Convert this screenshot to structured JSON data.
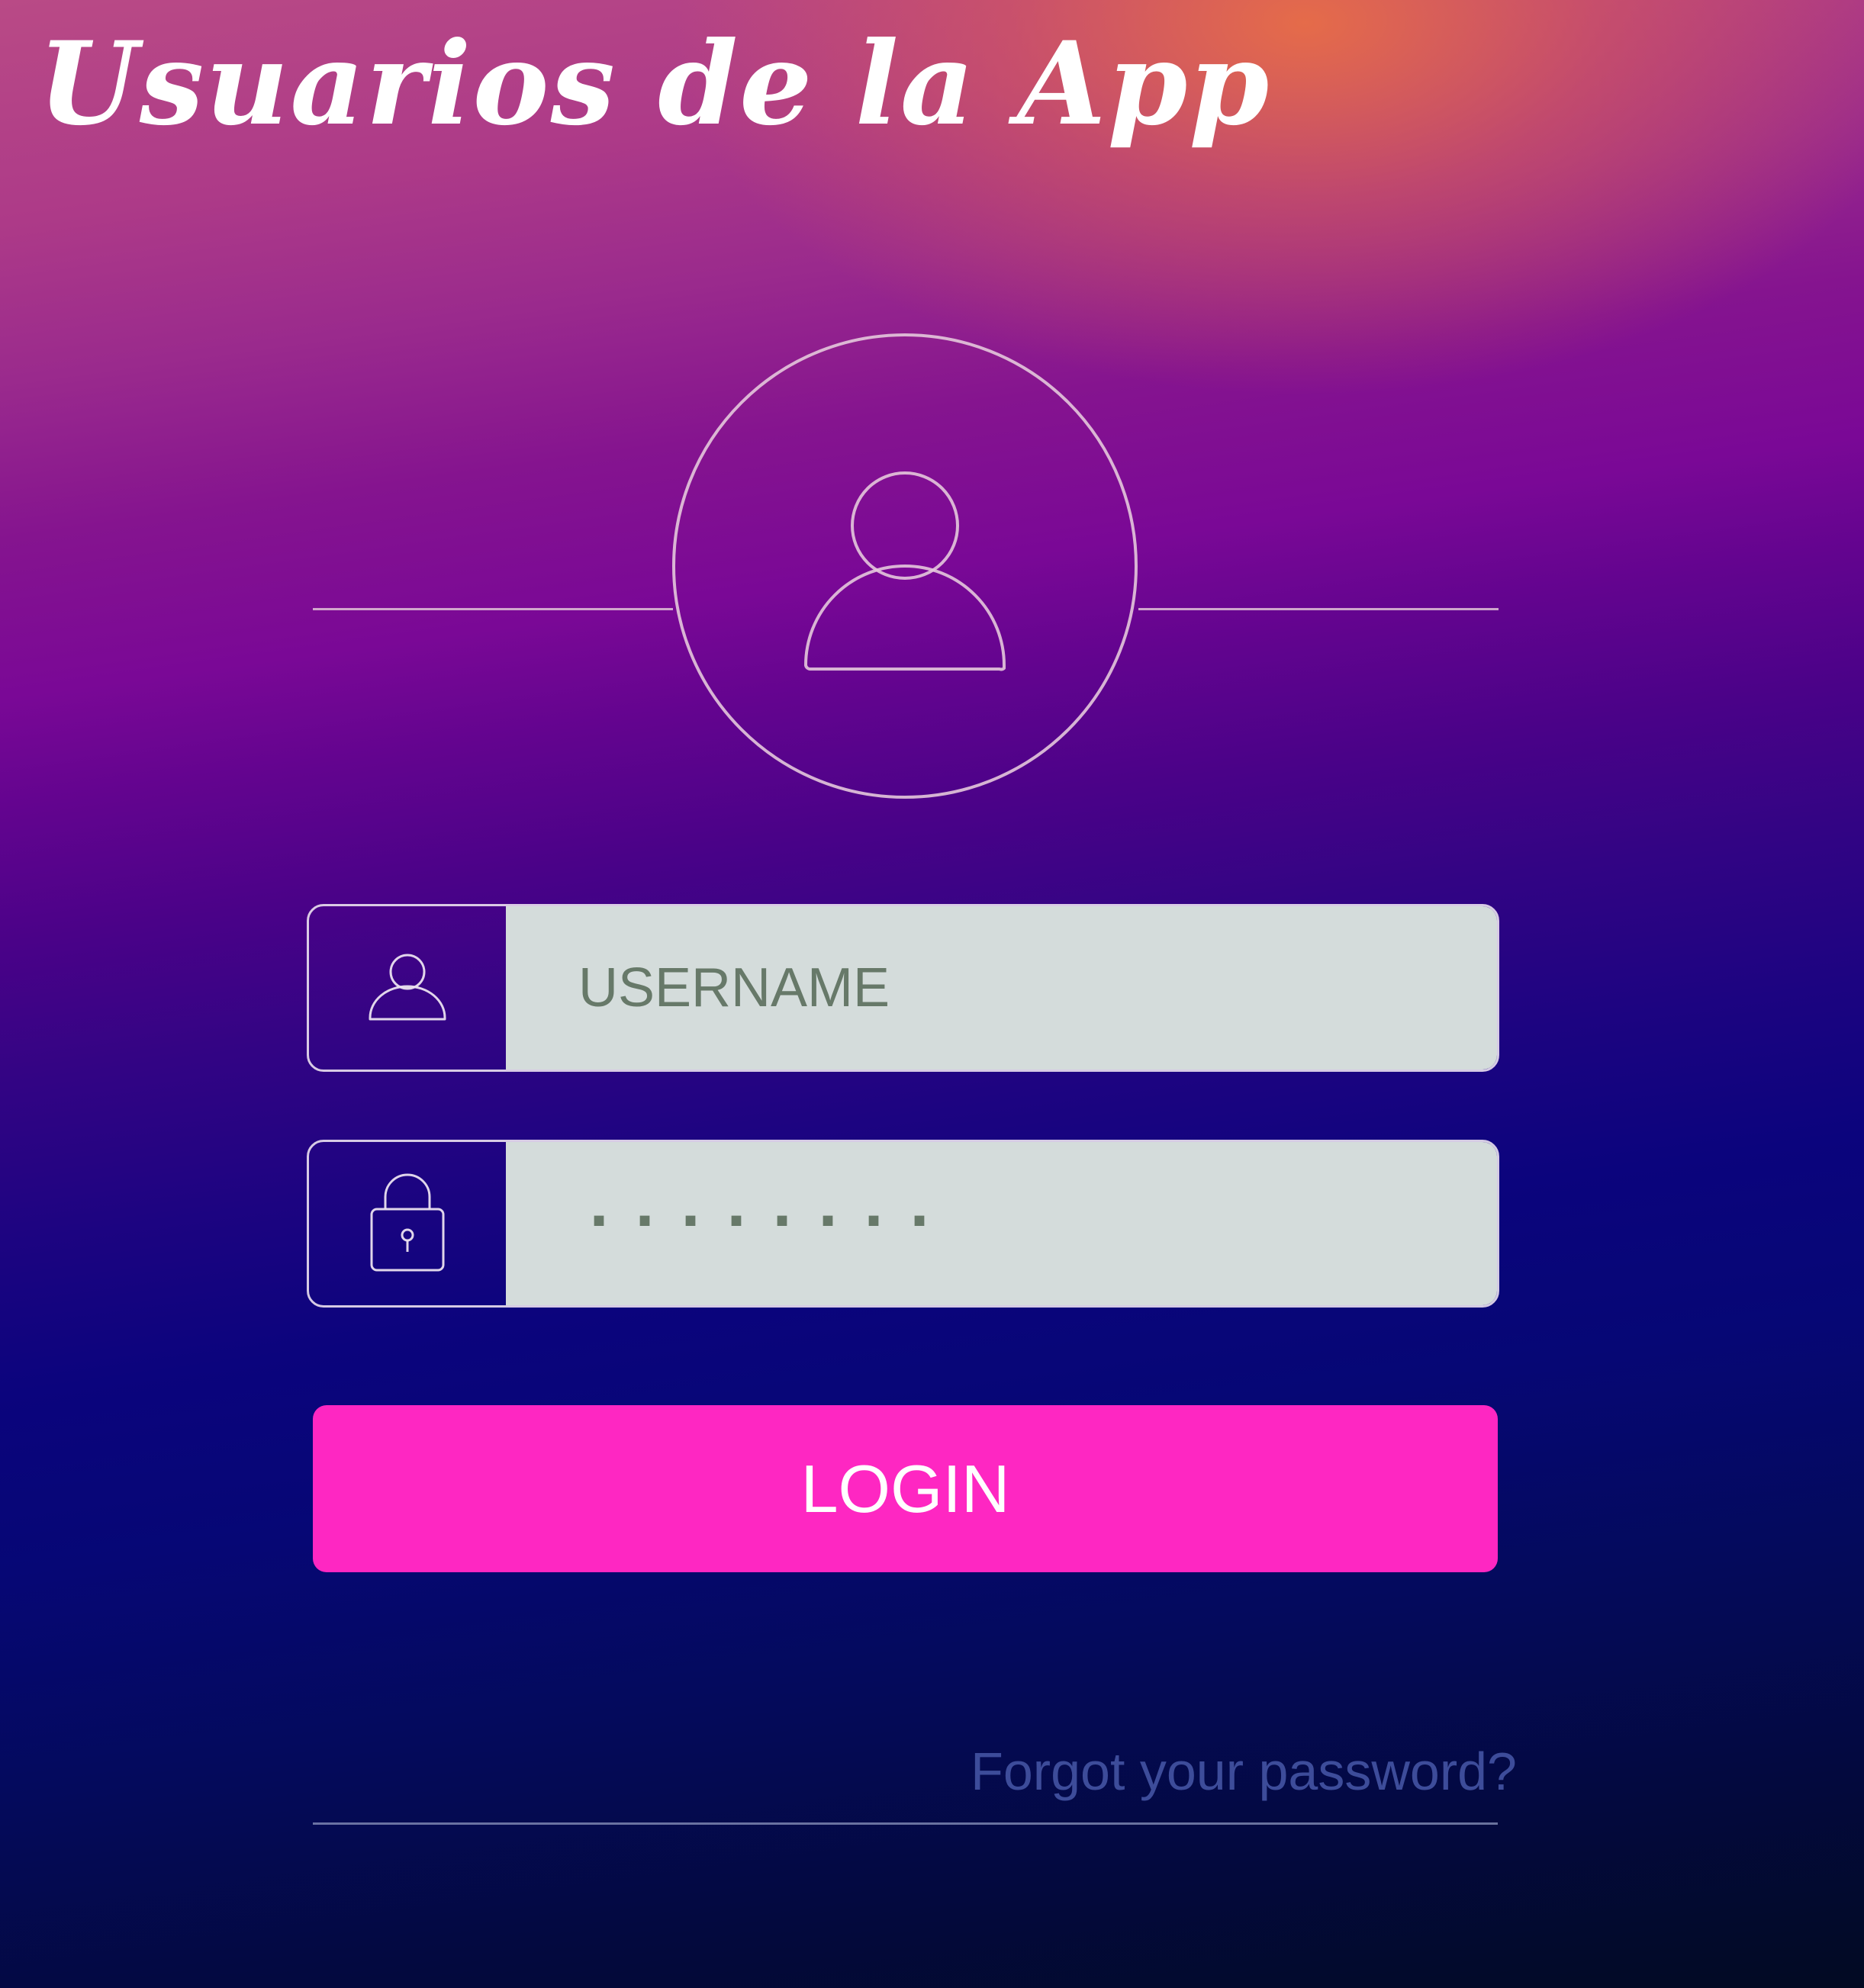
{
  "header": {
    "title": "Usuarios de la App"
  },
  "login_form": {
    "username_placeholder": "USERNAME",
    "password_mask": "........",
    "login_label": "LOGIN",
    "forgot_label": "Forgot your password?"
  },
  "icons": {
    "avatar": "user-icon",
    "username_field": "user-icon",
    "password_field": "lock-icon"
  },
  "colors": {
    "login_button": "#fe27c2",
    "input_background": "#d4dcdb",
    "input_text": "#677969",
    "forgot_link": "#3d4c9a"
  }
}
